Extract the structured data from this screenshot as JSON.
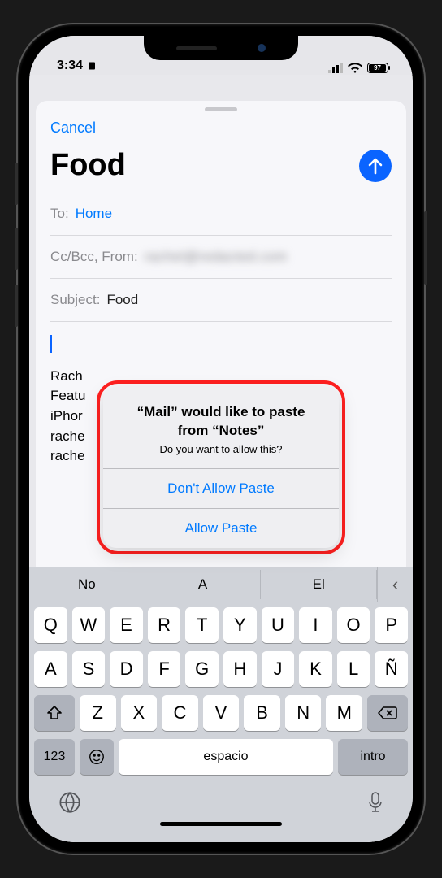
{
  "status": {
    "time": "3:34",
    "battery_pct": "97"
  },
  "nav": {
    "cancel": "Cancel"
  },
  "title": "Food",
  "fields": {
    "to_label": "To:",
    "to_value": "Home",
    "cc_label": "Cc/Bcc, From:",
    "cc_value": "rachel@redacted.com",
    "subject_label": "Subject:",
    "subject_value": "Food"
  },
  "body": {
    "sig_lines": [
      "Rach",
      "Featu",
      "iPhor",
      "rache",
      "rache"
    ]
  },
  "alert": {
    "title": "“Mail” would like to paste from “Notes”",
    "message": "Do you want to allow this?",
    "deny": "Don't Allow Paste",
    "allow": "Allow Paste"
  },
  "keyboard": {
    "predictions": [
      "No",
      "A",
      "El"
    ],
    "collapse_glyph": "‹",
    "row1": [
      "Q",
      "W",
      "E",
      "R",
      "T",
      "Y",
      "U",
      "I",
      "O",
      "P"
    ],
    "row2": [
      "A",
      "S",
      "D",
      "F",
      "G",
      "H",
      "J",
      "K",
      "L",
      "Ñ"
    ],
    "row3": [
      "Z",
      "X",
      "C",
      "V",
      "B",
      "N",
      "M"
    ],
    "numkey": "123",
    "space": "espacio",
    "enter": "intro"
  }
}
